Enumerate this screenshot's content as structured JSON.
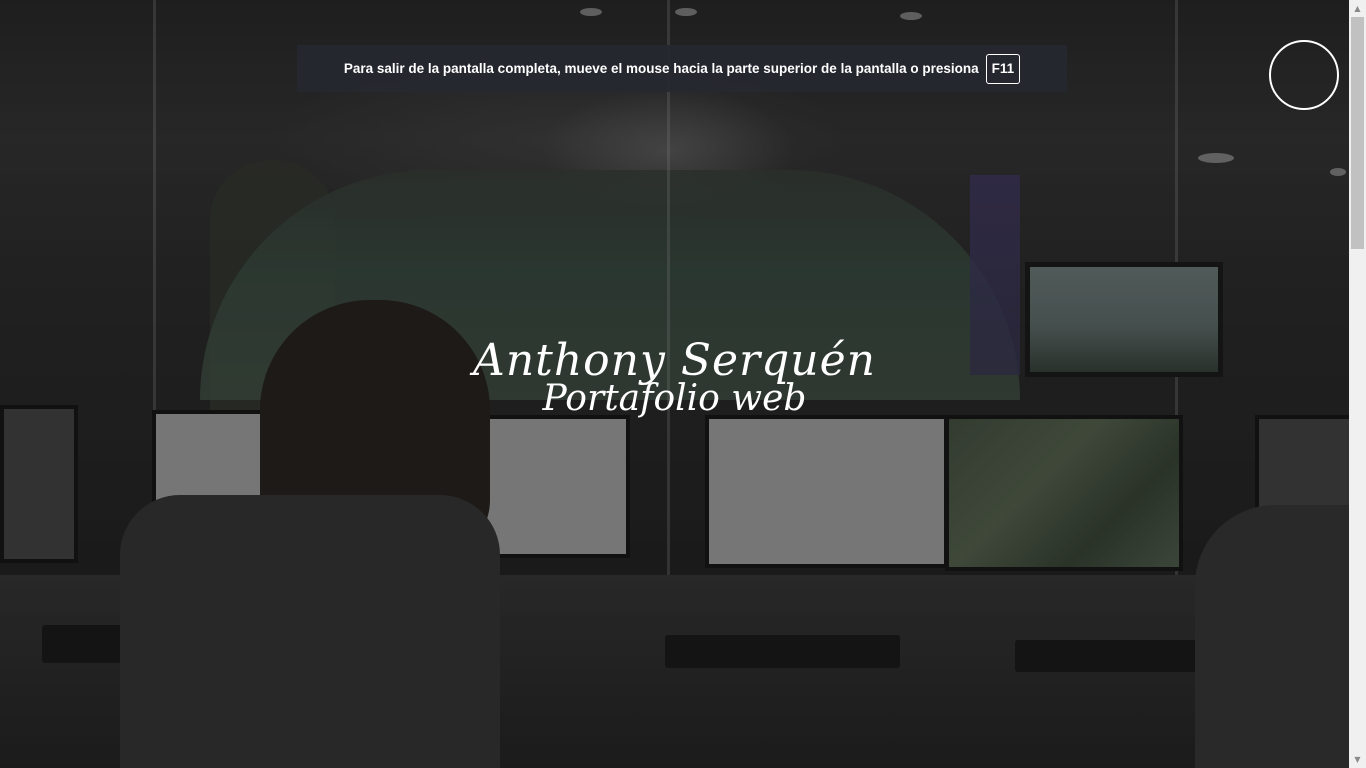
{
  "fullscreen_notice": {
    "text": "Para salir de la pantalla completa, mueve el mouse hacia la parte superior de la pantalla o presiona",
    "key": "F11"
  },
  "hero": {
    "name": "Anthony Serquén",
    "subtitle": "Portafolio web"
  },
  "menu": {
    "icon": "menu-circle-icon"
  },
  "scrollbar": {
    "up_arrow": "▲",
    "down_arrow": "▼"
  }
}
